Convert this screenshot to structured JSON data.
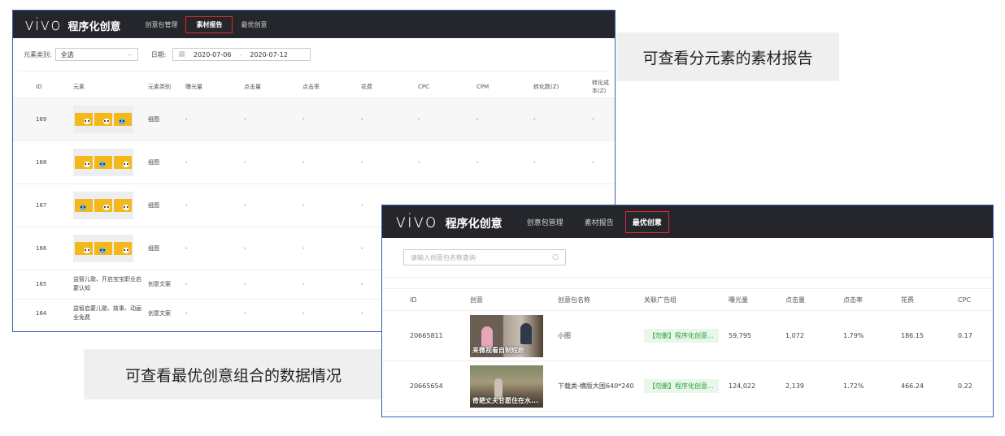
{
  "win1": {
    "nav": {
      "logo": "vivo",
      "product": "程序化创意",
      "items": [
        "创意包管理",
        "素材报告",
        "最优创意"
      ],
      "active": 1
    },
    "filters": {
      "type_label": "元素类别:",
      "type_value": "全选",
      "date_label": "日期:",
      "date_from": "2020-07-06",
      "date_sep": "-",
      "date_to": "2020-07-12"
    },
    "headers": [
      "ID",
      "元素",
      "元素类别",
      "曝光量",
      "点击量",
      "点击率",
      "花费",
      "CPC",
      "CPM",
      "转化数(Z)",
      "转化成本(Z)"
    ],
    "rows": [
      {
        "id": "169",
        "category": "组图",
        "values": [
          "-",
          "-",
          "-",
          "-",
          "-",
          "-",
          "-",
          "-"
        ]
      },
      {
        "id": "168",
        "category": "组图",
        "values": [
          "-",
          "-",
          "-",
          "-",
          "-",
          "-",
          "-",
          "-"
        ]
      },
      {
        "id": "167",
        "category": "组图",
        "values": [
          "-",
          "-",
          "-",
          "-",
          "-",
          "-",
          "-",
          "-"
        ]
      },
      {
        "id": "166",
        "category": "组图",
        "values": [
          "-",
          "-",
          "-",
          "-",
          "-",
          "-",
          "-",
          "-"
        ]
      },
      {
        "id": "165",
        "text": "益智儿歌、开启宝宝职业启蒙认知",
        "category": "创意文案",
        "values": [
          "-",
          "-",
          "-",
          "-",
          "-",
          "-",
          "-",
          "-"
        ]
      },
      {
        "id": "164",
        "text": "益智启蒙儿歌、故事、动画全免费",
        "category": "创意文案",
        "values": [
          "-",
          "-",
          "-",
          "-",
          "-",
          "-",
          "-",
          "-"
        ]
      }
    ]
  },
  "callout1": "可查看分元素的素材报告",
  "callout2": "可查看最优创意组合的数据情况",
  "win2": {
    "nav": {
      "logo": "vivo",
      "product": "程序化创意",
      "items": [
        "创意包管理",
        "素材报告",
        "最优创意"
      ],
      "active": 2
    },
    "search_placeholder": "请输入创意包名称查询",
    "headers": [
      "ID",
      "创意",
      "创意包名称",
      "关联广告组",
      "曝光量",
      "点击量",
      "点击率",
      "花费",
      "CPC"
    ],
    "rows": [
      {
        "id": "20665811",
        "caption": "来微视看自制短剧",
        "package": "小图",
        "ad_group": "【勿删】程序化创意...",
        "exposure": "59,795",
        "clicks": "1,072",
        "ctr": "1.79%",
        "cost": "186.15",
        "cpc": "0.17"
      },
      {
        "id": "20665654",
        "caption": "奇葩丈夫甘愿住在水...",
        "package": "下载类-横版大图640*240",
        "ad_group": "【勿删】程序化创意...",
        "exposure": "124,022",
        "clicks": "2,139",
        "ctr": "1.72%",
        "cost": "466.24",
        "cpc": "0.22"
      }
    ]
  },
  "colors": {
    "nav_bg": "#25262b",
    "active_border": "#e0282e",
    "tag_green": "#23a33a",
    "frame_blue": "#3a5fb8"
  }
}
